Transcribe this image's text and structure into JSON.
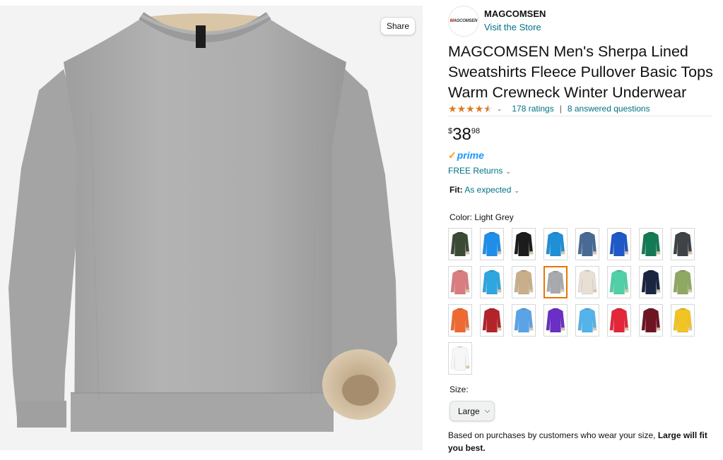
{
  "share_label": "Share",
  "brand": {
    "logo_text": "MAGCOMSEN",
    "name": "MAGCOMSEN",
    "visit_store": "Visit the Store"
  },
  "product_title": "MAGCOMSEN Men's Sherpa Lined Sweatshirts Fleece Pullover Basic Tops Warm Crewneck Winter Underwear",
  "rating": {
    "stars": 4.5,
    "ratings_text": "178 ratings",
    "separator": "|",
    "questions_text": "8 answered questions"
  },
  "price": {
    "currency": "$",
    "whole": "38",
    "fraction": "98"
  },
  "prime_label": "prime",
  "returns_label": "FREE Returns",
  "fit": {
    "label": "Fit:",
    "value": "As expected"
  },
  "color": {
    "label": "Color:",
    "selected": "Light Grey"
  },
  "swatch_colors": [
    "#3b4a35",
    "#1e8ee8",
    "#1c1c1c",
    "#1f8fd6",
    "#4a6a96",
    "#1f58c7",
    "#137a54",
    "#3f4247",
    "#d97d80",
    "#2ea6e0",
    "#c9ae8c",
    "#a8a9ac",
    "#e8e0d4",
    "#4fd0a6",
    "#1a2540",
    "#8fa862",
    "#ee6a32",
    "#b3242a",
    "#5aa3e6",
    "#6a2fc4",
    "#53b3ea",
    "#e3263a",
    "#6e1524",
    "#f1c424",
    "#f7f7f7"
  ],
  "selected_swatch_index": 11,
  "size": {
    "label": "Size:",
    "value": "Large"
  },
  "fit_note": {
    "text": "Based on purchases by customers who wear your size, ",
    "bold": "Large will fit you best."
  }
}
